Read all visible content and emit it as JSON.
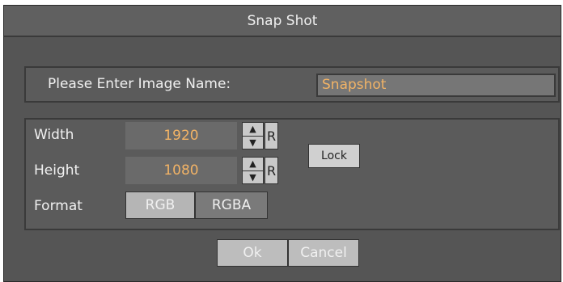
{
  "dialog": {
    "title": "Snap Shot"
  },
  "image_name": {
    "label": "Please Enter Image Name:",
    "value": "Snapshot"
  },
  "size": {
    "width_label": "Width",
    "width_value": "1920",
    "height_label": "Height",
    "height_value": "1080",
    "reset_label": "R",
    "lock_label": "Lock"
  },
  "format": {
    "label": "Format",
    "options": [
      "RGB",
      "RGBA"
    ],
    "selected": "RGB"
  },
  "buttons": {
    "ok": "Ok",
    "cancel": "Cancel"
  },
  "icons": {
    "spinner_up": "arrow-up-icon",
    "spinner_down": "arrow-down-icon"
  },
  "colors": {
    "value_text": "#f2b366",
    "panel_bg": "#555555"
  }
}
